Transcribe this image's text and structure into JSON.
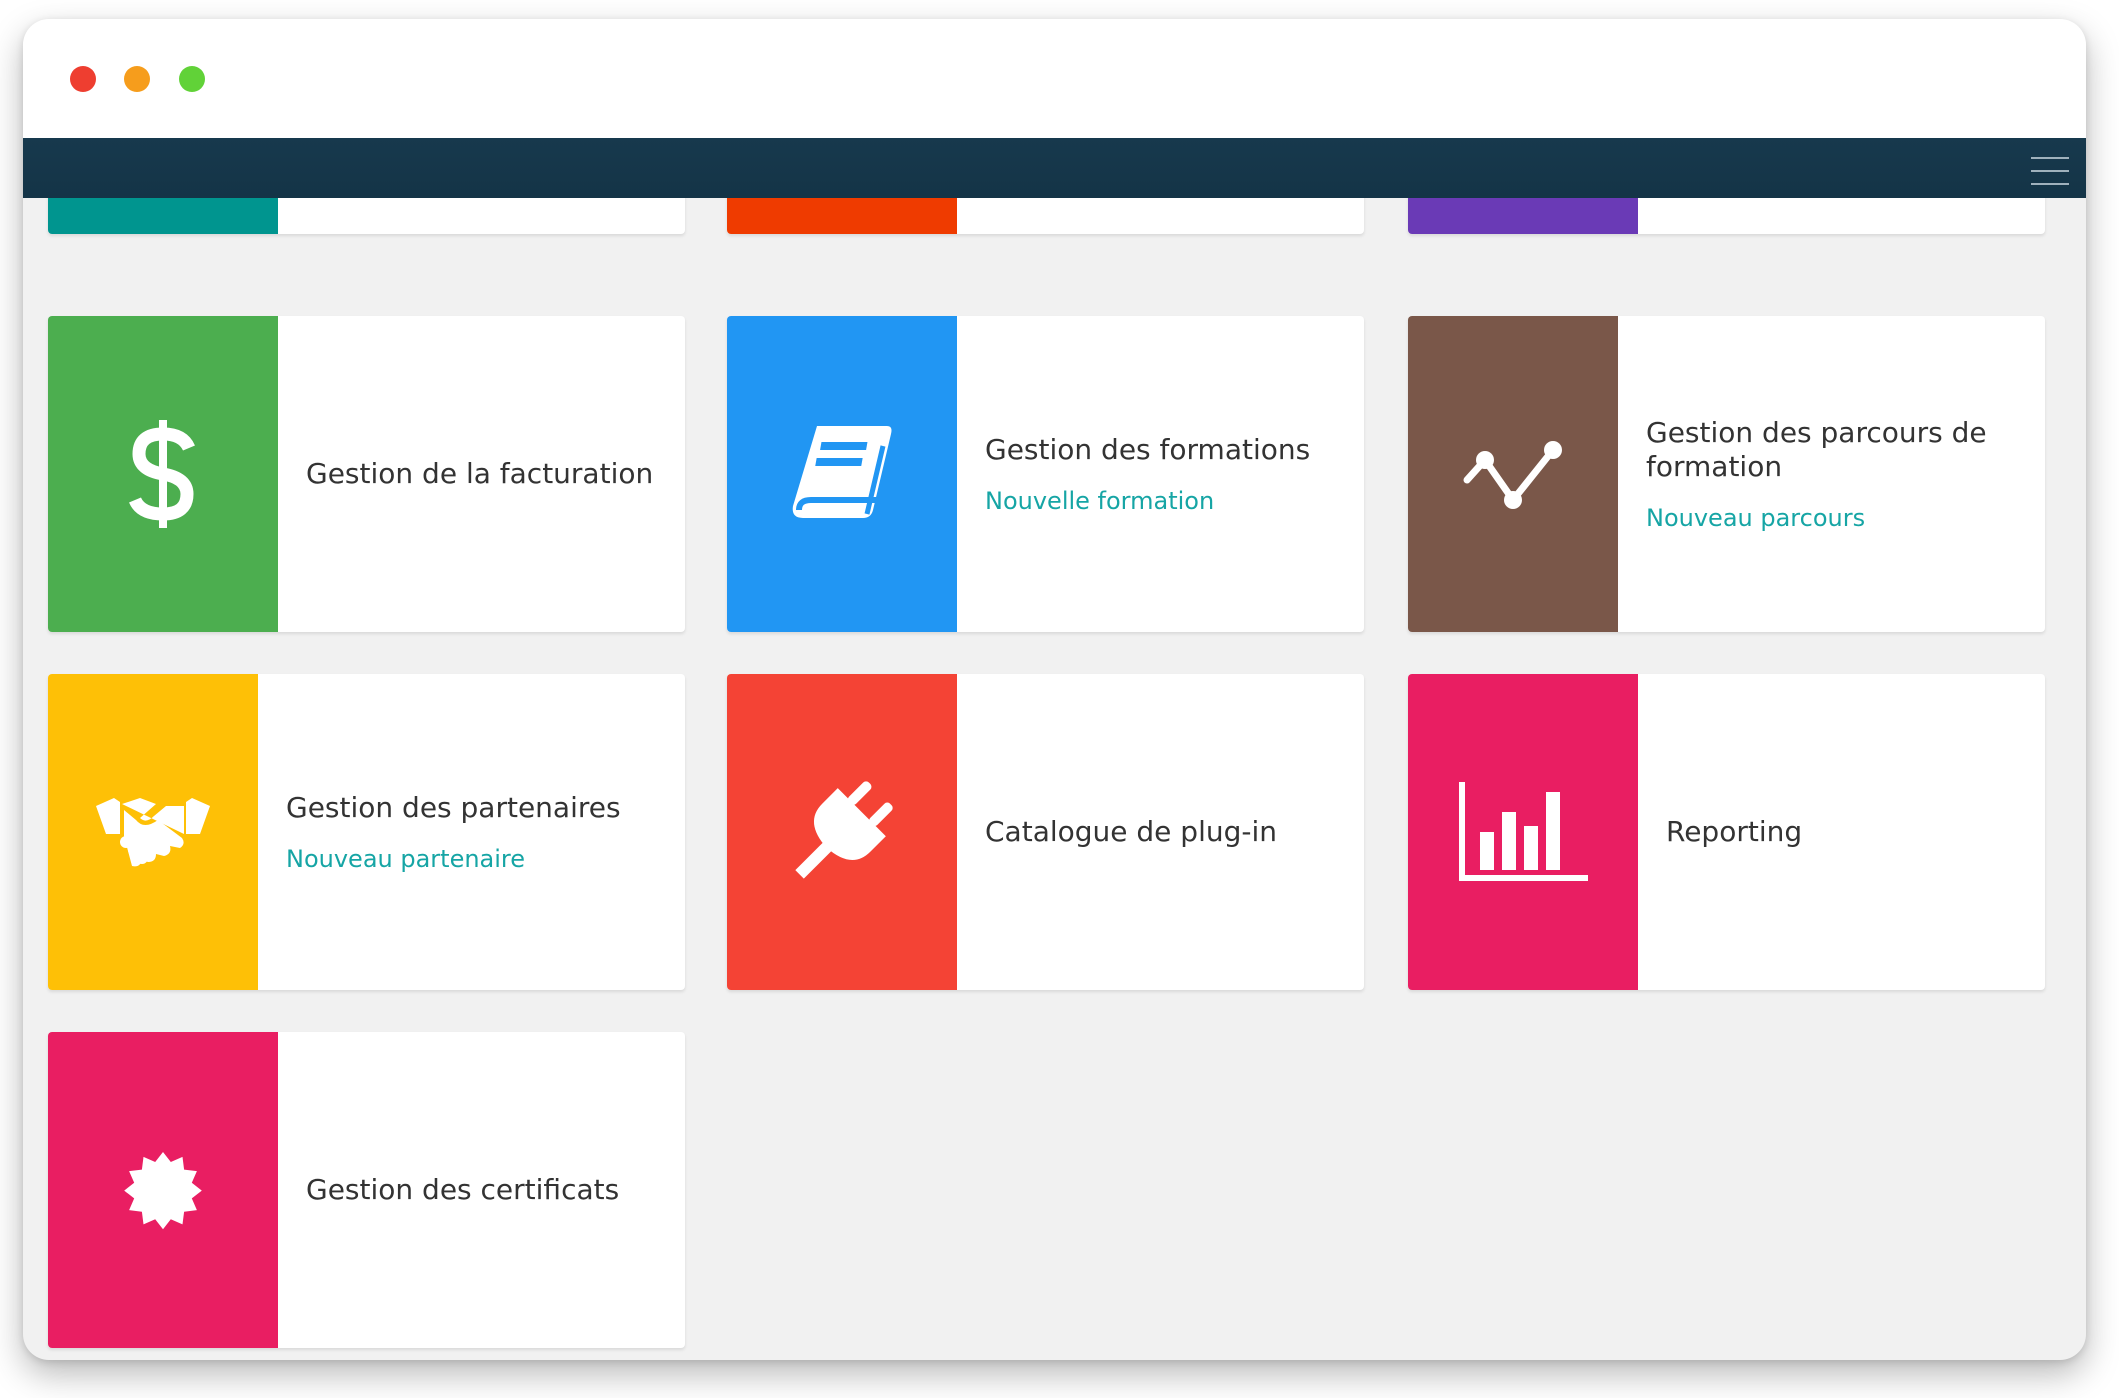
{
  "window": {
    "controls": [
      {
        "name": "close",
        "color": "#ee3e30"
      },
      {
        "name": "minimize",
        "color": "#f69d1c"
      },
      {
        "name": "maximize",
        "color": "#61d238"
      }
    ]
  },
  "navbar": {
    "background": "#163749",
    "menu_icon": "hamburger-menu-icon"
  },
  "partial_row": {
    "tile_colors": [
      "#00958f",
      "#ef3b00",
      "#6a3ab6"
    ]
  },
  "cards": [
    {
      "id": "billing",
      "title": "Gestion de la facturation",
      "link": "",
      "icon": "dollar-sign-icon",
      "color": "#4cae4f"
    },
    {
      "id": "trainings",
      "title": "Gestion des formations",
      "link": "Nouvelle formation",
      "icon": "book-icon",
      "color": "#2196f3"
    },
    {
      "id": "paths",
      "title": "Gestion des parcours de formation",
      "link": "Nouveau parcours",
      "icon": "line-chart-icon",
      "color": "#7a5749"
    },
    {
      "id": "partners",
      "title": "Gestion des partenaires",
      "link": "Nouveau partenaire",
      "icon": "handshake-icon",
      "color": "#fec006"
    },
    {
      "id": "plugins",
      "title": "Catalogue de plug-in",
      "link": "",
      "icon": "plug-icon",
      "color": "#f44335"
    },
    {
      "id": "reporting",
      "title": "Reporting",
      "link": "",
      "icon": "bar-chart-icon",
      "color": "#e91e62"
    },
    {
      "id": "certificates",
      "title": "Gestion des certificats",
      "link": "",
      "icon": "certificate-badge-icon",
      "color": "#e91e62"
    }
  ]
}
